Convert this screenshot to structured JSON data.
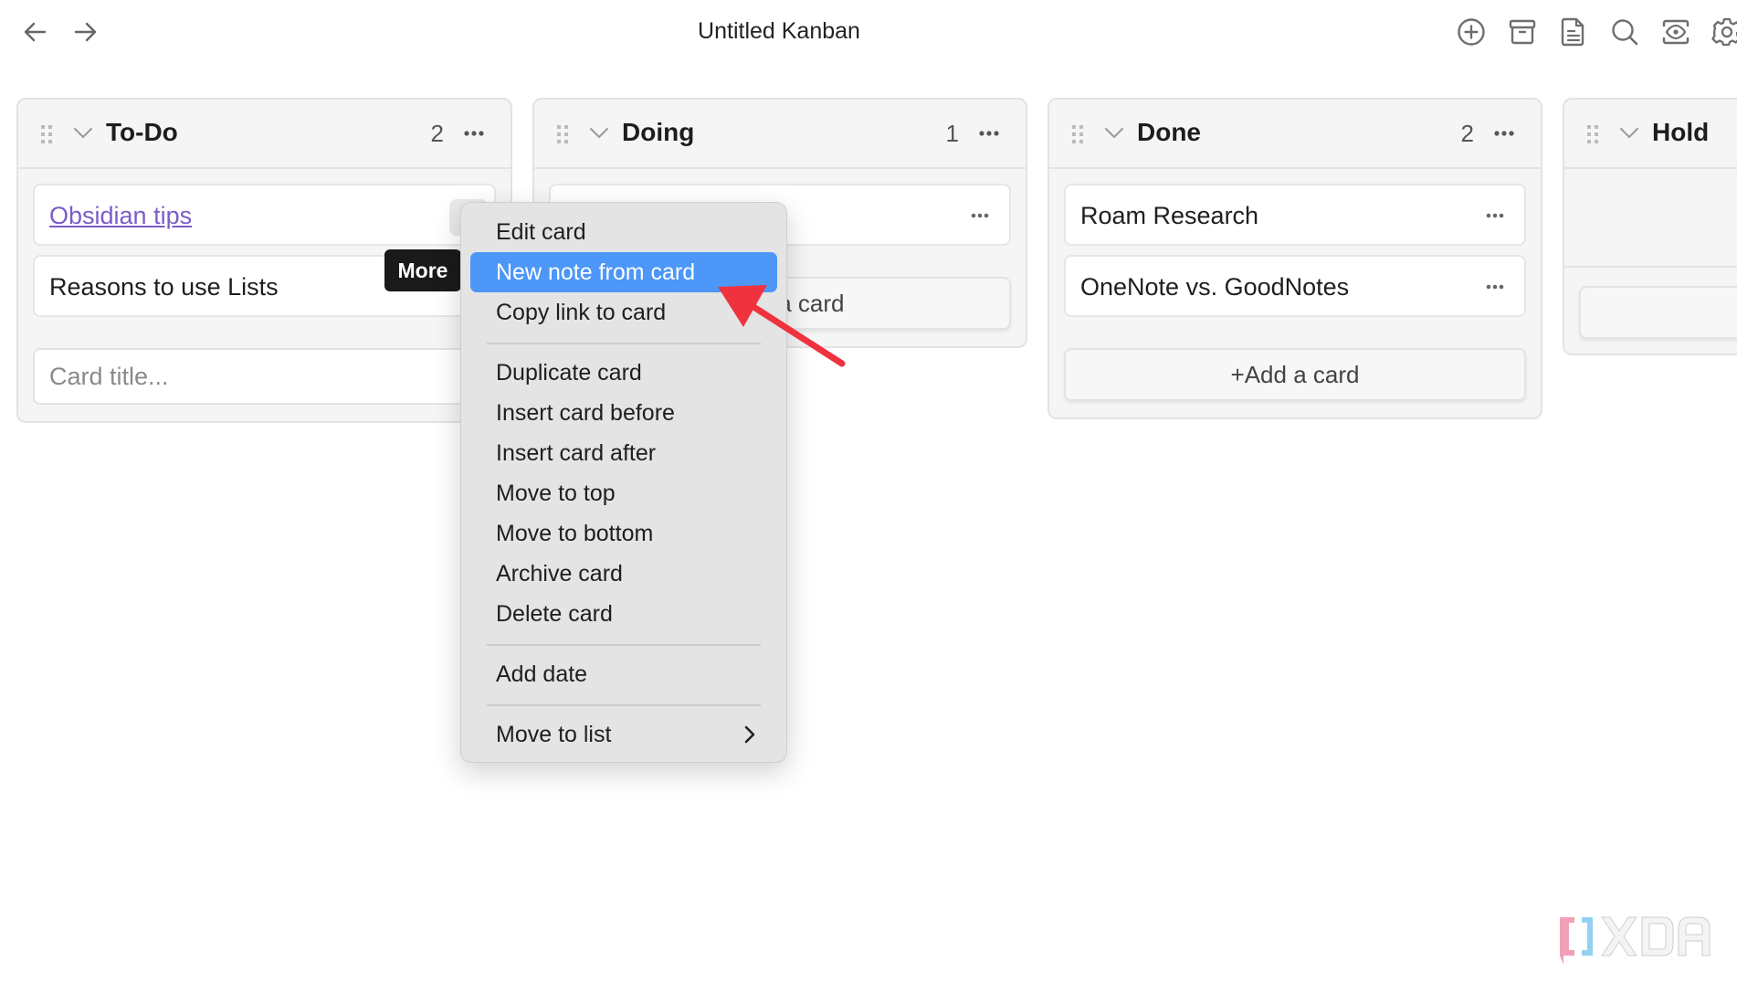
{
  "window": {
    "title": "Untitled Kanban"
  },
  "nav": {
    "back_icon": "arrow-left-icon",
    "forward_icon": "arrow-right-icon"
  },
  "toolbar": [
    {
      "name": "add-list",
      "icon": "plus-circle-icon"
    },
    {
      "name": "archive",
      "icon": "archive-box-icon"
    },
    {
      "name": "open-as-markdown",
      "icon": "document-icon"
    },
    {
      "name": "search",
      "icon": "search-icon"
    },
    {
      "name": "view-mode",
      "icon": "eye-scan-icon"
    },
    {
      "name": "settings",
      "icon": "gear-icon"
    }
  ],
  "lanes": [
    {
      "title": "To-Do",
      "count": "2",
      "cards": [
        {
          "text": "Obsidian tips",
          "is_link": true
        },
        {
          "text": "Reasons to use Lists",
          "is_link": false
        }
      ],
      "new_card_placeholder": "Card title..."
    },
    {
      "title": "Doing",
      "count": "1",
      "cards": [
        {
          "text": "",
          "is_link": false
        }
      ],
      "add_card_label": "+Add a card"
    },
    {
      "title": "Done",
      "count": "2",
      "cards": [
        {
          "text": "Roam Research",
          "is_link": false
        },
        {
          "text": "OneNote vs. GoodNotes",
          "is_link": false
        }
      ],
      "add_card_label": "+Add a card"
    },
    {
      "title": "Hold",
      "count": "",
      "cards": []
    }
  ],
  "tooltip": {
    "text": "More"
  },
  "context_menu": {
    "groups": [
      [
        "Edit card",
        "New note from card",
        "Copy link to card"
      ],
      [
        "Duplicate card",
        "Insert card before",
        "Insert card after",
        "Move to top",
        "Move to bottom",
        "Archive card",
        "Delete card"
      ],
      [
        "Add date"
      ],
      [
        "Move to list"
      ]
    ],
    "highlighted": "New note from card",
    "submenu_item": "Move to list"
  },
  "annotation": {
    "type": "arrow",
    "color": "#f0323f",
    "points_to": "New note from card"
  },
  "colors": {
    "accent": "#4c97f7",
    "link": "#7b5cc8",
    "lane_bg": "#f5f5f5"
  },
  "watermark": {
    "text": "XDA"
  }
}
